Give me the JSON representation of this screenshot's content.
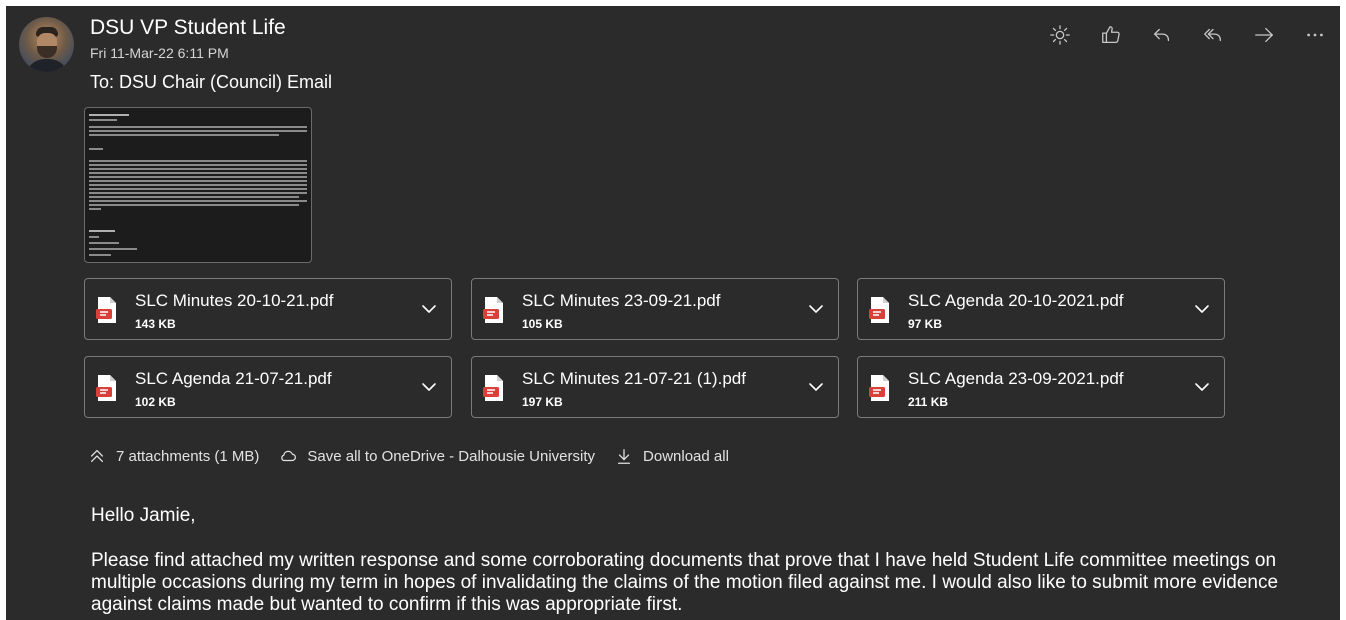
{
  "email": {
    "sender": "DSU VP Student Life",
    "date": "Fri 11-Mar-22 6:11 PM",
    "to": "To:  DSU Chair (Council) Email",
    "greeting": "Hello Jamie,",
    "body": "Please find attached my written response and some corroborating documents that prove that I have held Student Life committee meetings on multiple occasions during my term in hopes of invalidating the claims of the motion filed against me. I would also like to submit more evidence against claims made but wanted to confirm if this was appropriate first."
  },
  "actions": [
    {
      "name": "sun-icon"
    },
    {
      "name": "thumbs-up-icon"
    },
    {
      "name": "reply-icon"
    },
    {
      "name": "reply-all-icon"
    },
    {
      "name": "forward-icon"
    },
    {
      "name": "more-icon"
    }
  ],
  "attachments": [
    {
      "name": "SLC Minutes 20-10-21.pdf",
      "size": "143 KB"
    },
    {
      "name": "SLC Minutes 23-09-21.pdf",
      "size": "105 KB"
    },
    {
      "name": "SLC Agenda 20-10-2021.pdf",
      "size": "97 KB"
    },
    {
      "name": "SLC Agenda 21-07-21.pdf",
      "size": "102 KB"
    },
    {
      "name": "SLC Minutes 21-07-21 (1).pdf",
      "size": "197 KB"
    },
    {
      "name": "SLC Agenda 23-09-2021.pdf",
      "size": "211 KB"
    }
  ],
  "attachment_bar": {
    "count": "7 attachments (1 MB)",
    "save_all": "Save all to OneDrive - Dalhousie University",
    "download_all": "Download all"
  },
  "colors": {
    "background": "#2b2b2b",
    "pdf_red": "#d9403a"
  }
}
